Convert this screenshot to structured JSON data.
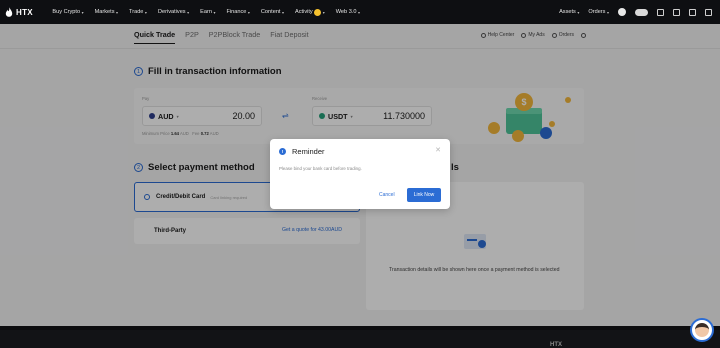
{
  "nav": {
    "logo_text": "HTX",
    "items": [
      {
        "label": "Buy Crypto"
      },
      {
        "label": "Markets"
      },
      {
        "label": "Trade"
      },
      {
        "label": "Derivatives"
      },
      {
        "label": "Earn"
      },
      {
        "label": "Finance"
      },
      {
        "label": "Content"
      },
      {
        "label": "Activity"
      },
      {
        "label": "Web 3.0"
      }
    ],
    "assets_label": "Assets",
    "orders_label": "Orders"
  },
  "subnav": {
    "tabs": [
      {
        "label": "Quick Trade",
        "active": true
      },
      {
        "label": "P2P",
        "active": false
      },
      {
        "label": "P2PBlock Trade",
        "active": false
      },
      {
        "label": "Fiat Deposit",
        "active": false
      }
    ],
    "links": [
      {
        "label": "Help Center"
      },
      {
        "label": "My Ads"
      },
      {
        "label": "Orders"
      }
    ]
  },
  "step1": {
    "num": "1",
    "title": "Fill in transaction information",
    "pay_label": "Pay",
    "pay_currency": "AUD",
    "pay_amount": "20.00",
    "receive_label": "Receive",
    "receive_currency": "USDT",
    "receive_amount": "11.730000",
    "minimum_label": "Minimum Price",
    "minimum_value": "1.64",
    "minimum_unit": "AUD",
    "fee_label": "Fee",
    "fee_value": "0.72",
    "fee_unit": "AUD"
  },
  "step2": {
    "num": "2",
    "title": "Select payment method",
    "methods": [
      {
        "label": "Credit/Debit Card",
        "sub": "Card linking required"
      },
      {
        "label": "Third-Party",
        "sub": ""
      }
    ],
    "quote_link": "Get a quote for 43.00AUD",
    "details_partial": "ls",
    "details_empty": "Transaction details will be shown here once a payment method is selected"
  },
  "modal": {
    "title": "Reminder",
    "message": "Please bind your bank card before trading.",
    "cancel_label": "Cancel",
    "confirm_label": "Link Now"
  },
  "footer": {
    "logo_text": "HTX"
  },
  "colors": {
    "accent": "#2b6cd4",
    "nav_bg": "#0e0f12"
  }
}
